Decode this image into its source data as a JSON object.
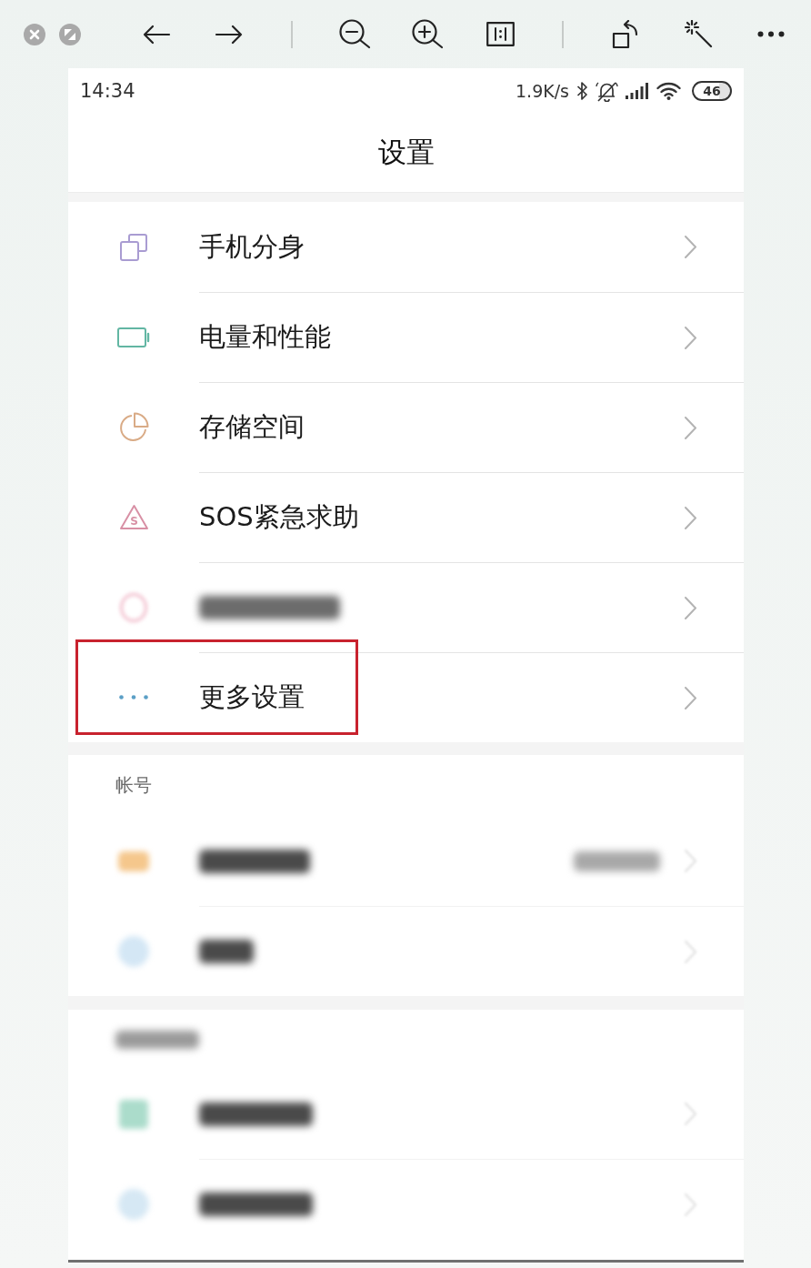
{
  "status_bar": {
    "time": "14:34",
    "net_speed": "1.9K/s",
    "battery": "46"
  },
  "header": {
    "title": "设置"
  },
  "settings_rows": [
    {
      "kind": "item",
      "label": "手机分身",
      "highlighted": false
    },
    {
      "kind": "item",
      "label": "电量和性能",
      "highlighted": false
    },
    {
      "kind": "item",
      "label": "存储空间",
      "highlighted": false
    },
    {
      "kind": "item",
      "label": "SOS紧急求助",
      "icon_letter": "S",
      "highlighted": false
    },
    {
      "kind": "blurred",
      "highlighted": false
    },
    {
      "kind": "item",
      "label": "更多设置",
      "highlighted": true
    }
  ],
  "sections": [
    {
      "header": {
        "kind": "text",
        "text": "帐号"
      },
      "rows": [
        {
          "kind": "blurred",
          "detail": true
        },
        {
          "kind": "blurred",
          "detail": false
        }
      ]
    },
    {
      "header": {
        "kind": "blurred"
      },
      "rows": [
        {
          "kind": "blurred",
          "detail": false
        },
        {
          "kind": "blurred",
          "detail": false
        }
      ]
    }
  ]
}
